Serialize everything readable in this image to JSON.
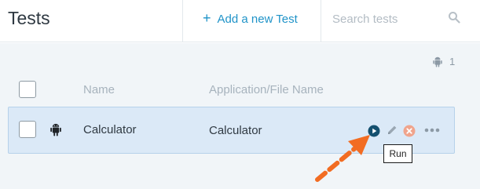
{
  "header": {
    "title": "Tests",
    "add_label": "Add a new Test",
    "add_plus": "+",
    "search_placeholder": "Search tests"
  },
  "device_filter": {
    "count": "1",
    "icon": "android-icon"
  },
  "table": {
    "columns": [
      "Name",
      "Application/File Name"
    ],
    "rows": [
      {
        "name": "Calculator",
        "application": "Calculator",
        "platform": "android"
      }
    ]
  },
  "row_actions": {
    "run": "run-icon",
    "edit": "edit-icon",
    "delete": "delete-icon",
    "more": "more-icon"
  },
  "tooltip": {
    "text": "Run"
  },
  "colors": {
    "accent": "#1f93c8",
    "row_selected": "#dbe9f7",
    "run": "#14506f",
    "delete": "#f0a48c",
    "annotation_arrow": "#f26c22"
  }
}
